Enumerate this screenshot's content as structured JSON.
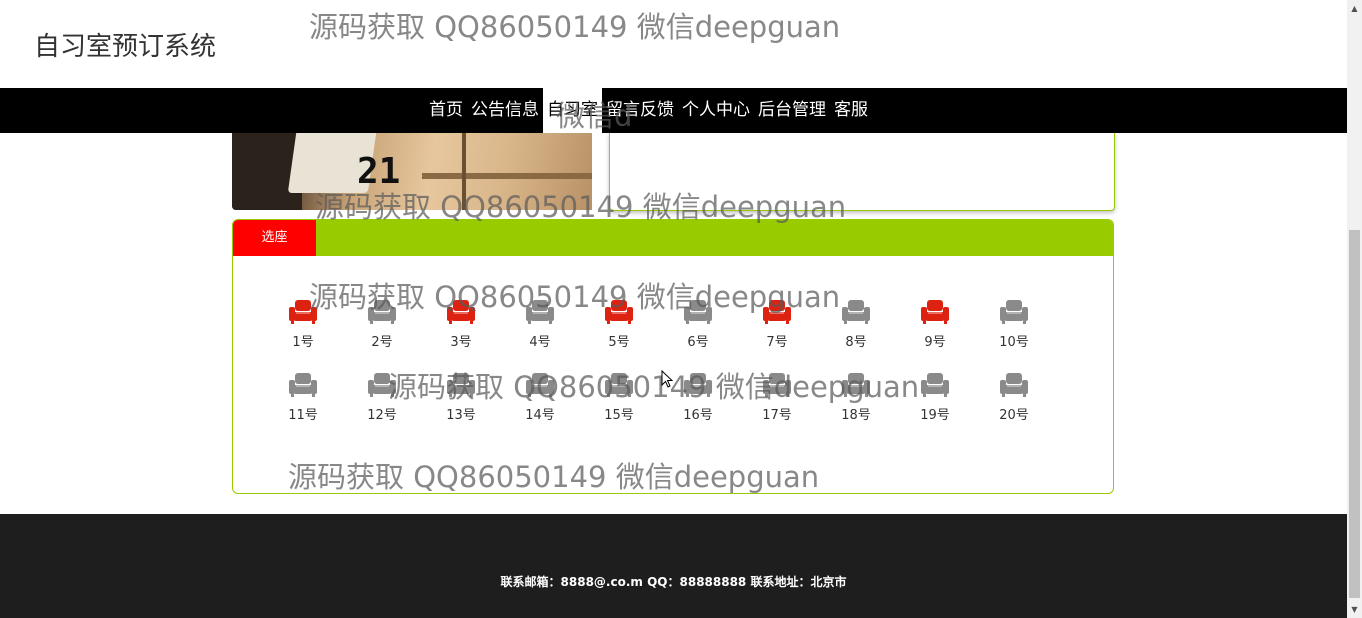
{
  "site_title": "自习室预订系统",
  "nav": [
    {
      "label": "首页",
      "active": false
    },
    {
      "label": "公告信息",
      "active": false
    },
    {
      "label": "自习室",
      "active": true
    },
    {
      "label": "留言反馈",
      "active": false
    },
    {
      "label": "个人中心",
      "active": false
    },
    {
      "label": "后台管理",
      "active": false
    },
    {
      "label": "客服",
      "active": false
    }
  ],
  "hero_image": {
    "number_text": "21"
  },
  "seat_panel": {
    "tab_label": "选座",
    "seats": [
      {
        "label": "1号",
        "occupied": true
      },
      {
        "label": "2号",
        "occupied": false
      },
      {
        "label": "3号",
        "occupied": true
      },
      {
        "label": "4号",
        "occupied": false
      },
      {
        "label": "5号",
        "occupied": true
      },
      {
        "label": "6号",
        "occupied": false
      },
      {
        "label": "7号",
        "occupied": true
      },
      {
        "label": "8号",
        "occupied": false
      },
      {
        "label": "9号",
        "occupied": true
      },
      {
        "label": "10号",
        "occupied": false
      },
      {
        "label": "11号",
        "occupied": false
      },
      {
        "label": "12号",
        "occupied": false
      },
      {
        "label": "13号",
        "occupied": false
      },
      {
        "label": "14号",
        "occupied": false
      },
      {
        "label": "15号",
        "occupied": false
      },
      {
        "label": "16号",
        "occupied": false
      },
      {
        "label": "17号",
        "occupied": false
      },
      {
        "label": "18号",
        "occupied": false
      },
      {
        "label": "19号",
        "occupied": false
      },
      {
        "label": "20号",
        "occupied": false
      }
    ]
  },
  "footer": {
    "text": "联系邮箱：8888@.co.m QQ：88888888 联系地址：北京市"
  },
  "watermark": {
    "text": "源码获取 QQ86050149 微信deepguan",
    "fragment": "微信d"
  },
  "colors": {
    "accent_green": "#99cc00",
    "tab_red": "#ff0000",
    "seat_occupied": "#dd2211",
    "seat_free": "#8a8a8a",
    "nav_bg": "#000000",
    "footer_bg": "#1e1e1e"
  }
}
